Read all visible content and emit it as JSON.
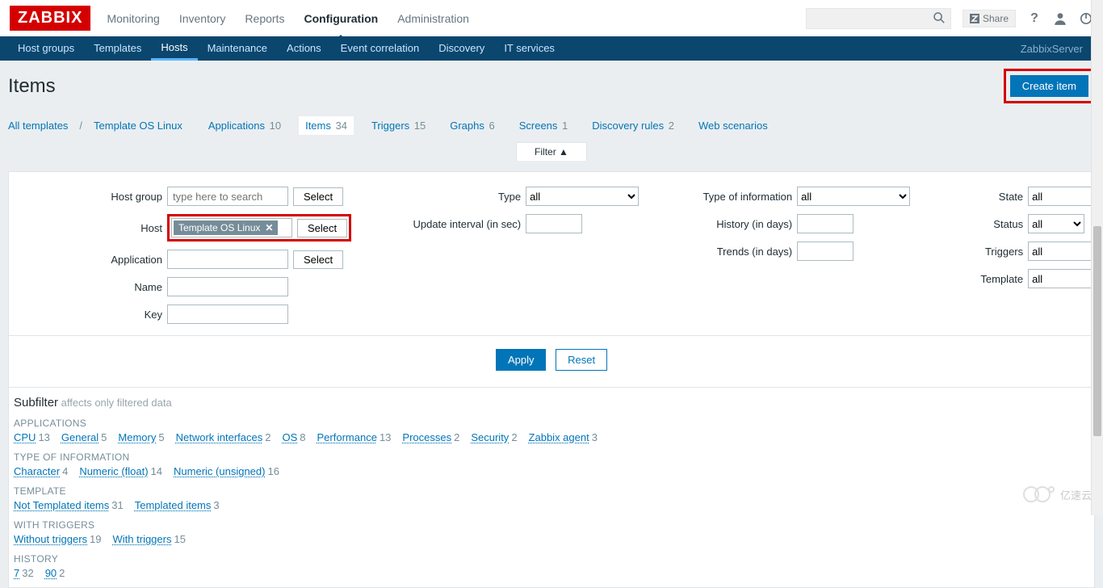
{
  "brand": "ZABBIX",
  "top_menu": [
    "Monitoring",
    "Inventory",
    "Reports",
    "Configuration",
    "Administration"
  ],
  "top_active": "Configuration",
  "share_label": "Share",
  "nav_menu": [
    "Host groups",
    "Templates",
    "Hosts",
    "Maintenance",
    "Actions",
    "Event correlation",
    "Discovery",
    "IT services"
  ],
  "nav_active": "Hosts",
  "nav_right": "ZabbixServer",
  "page_title": "Items",
  "create_btn": "Create item",
  "breadcrumb": {
    "all_templates": "All templates",
    "template_link": "Template OS Linux",
    "tabs": [
      {
        "label": "Applications",
        "count": "10"
      },
      {
        "label": "Items",
        "count": "34",
        "active": true
      },
      {
        "label": "Triggers",
        "count": "15"
      },
      {
        "label": "Graphs",
        "count": "6"
      },
      {
        "label": "Screens",
        "count": "1"
      },
      {
        "label": "Discovery rules",
        "count": "2"
      },
      {
        "label": "Web scenarios",
        "count": ""
      }
    ]
  },
  "filter": {
    "toggle": "Filter ▲",
    "hostgroup_label": "Host group",
    "hostgroup_placeholder": "type here to search",
    "select": "Select",
    "host_label": "Host",
    "host_token": "Template OS Linux",
    "application_label": "Application",
    "name_label": "Name",
    "key_label": "Key",
    "type_label": "Type",
    "type_value": "all",
    "update_label": "Update interval (in sec)",
    "toi_label": "Type of information",
    "toi_value": "all",
    "history_label": "History (in days)",
    "trends_label": "Trends (in days)",
    "state_label": "State",
    "state_value": "all",
    "status_label": "Status",
    "status_value": "all",
    "triggers_label": "Triggers",
    "triggers_value": "all",
    "template_label": "Template",
    "template_value": "all",
    "apply": "Apply",
    "reset": "Reset"
  },
  "subfilter": {
    "title": "Subfilter",
    "note": "affects only filtered data",
    "sections": [
      {
        "hd": "APPLICATIONS",
        "items": [
          {
            "l": "CPU",
            "n": "13"
          },
          {
            "l": "General",
            "n": "5"
          },
          {
            "l": "Memory",
            "n": "5"
          },
          {
            "l": "Network interfaces",
            "n": "2"
          },
          {
            "l": "OS",
            "n": "8"
          },
          {
            "l": "Performance",
            "n": "13"
          },
          {
            "l": "Processes",
            "n": "2"
          },
          {
            "l": "Security",
            "n": "2"
          },
          {
            "l": "Zabbix agent",
            "n": "3"
          }
        ]
      },
      {
        "hd": "TYPE OF INFORMATION",
        "items": [
          {
            "l": "Character",
            "n": "4"
          },
          {
            "l": "Numeric (float)",
            "n": "14"
          },
          {
            "l": "Numeric (unsigned)",
            "n": "16"
          }
        ]
      },
      {
        "hd": "TEMPLATE",
        "items": [
          {
            "l": "Not Templated items",
            "n": "31"
          },
          {
            "l": "Templated items",
            "n": "3"
          }
        ]
      },
      {
        "hd": "WITH TRIGGERS",
        "items": [
          {
            "l": "Without triggers",
            "n": "19"
          },
          {
            "l": "With triggers",
            "n": "15"
          }
        ]
      },
      {
        "hd": "HISTORY",
        "items": [
          {
            "l": "7",
            "n": "32"
          },
          {
            "l": "90",
            "n": "2"
          }
        ]
      }
    ]
  },
  "watermark": "亿速云"
}
